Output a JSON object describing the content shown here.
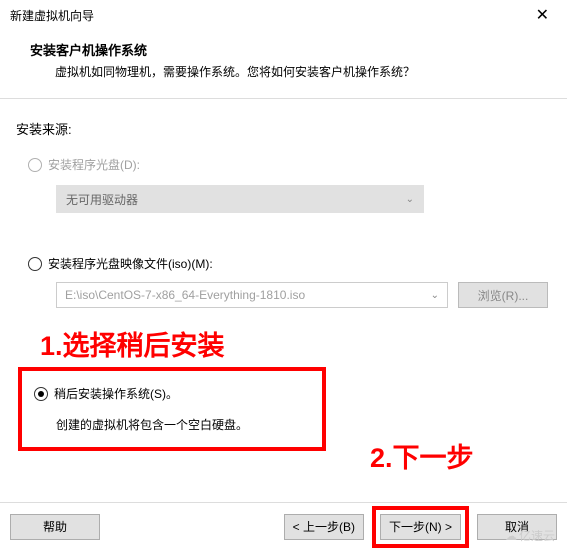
{
  "window": {
    "title": "新建虚拟机向导"
  },
  "header": {
    "title": "安装客户机操作系统",
    "subtitle": "虚拟机如同物理机，需要操作系统。您将如何安装客户机操作系统？"
  },
  "source_label": "安装来源:",
  "option_disc": {
    "label": "安装程序光盘(D):",
    "drive_text": "无可用驱动器"
  },
  "option_iso": {
    "label": "安装程序光盘映像文件(iso)(M):",
    "path": "E:\\iso\\CentOS-7-x86_64-Everything-1810.iso",
    "browse": "浏览(R)..."
  },
  "option_later": {
    "label": "稍后安装操作系统(S)。",
    "desc": "创建的虚拟机将包含一个空白硬盘。"
  },
  "annotations": {
    "a1": "1.选择稍后安装",
    "a2": "2.下一步"
  },
  "footer": {
    "help": "帮助",
    "back": "< 上一步(B)",
    "next": "下一步(N) >",
    "cancel": "取消"
  },
  "watermark": "亿速云"
}
